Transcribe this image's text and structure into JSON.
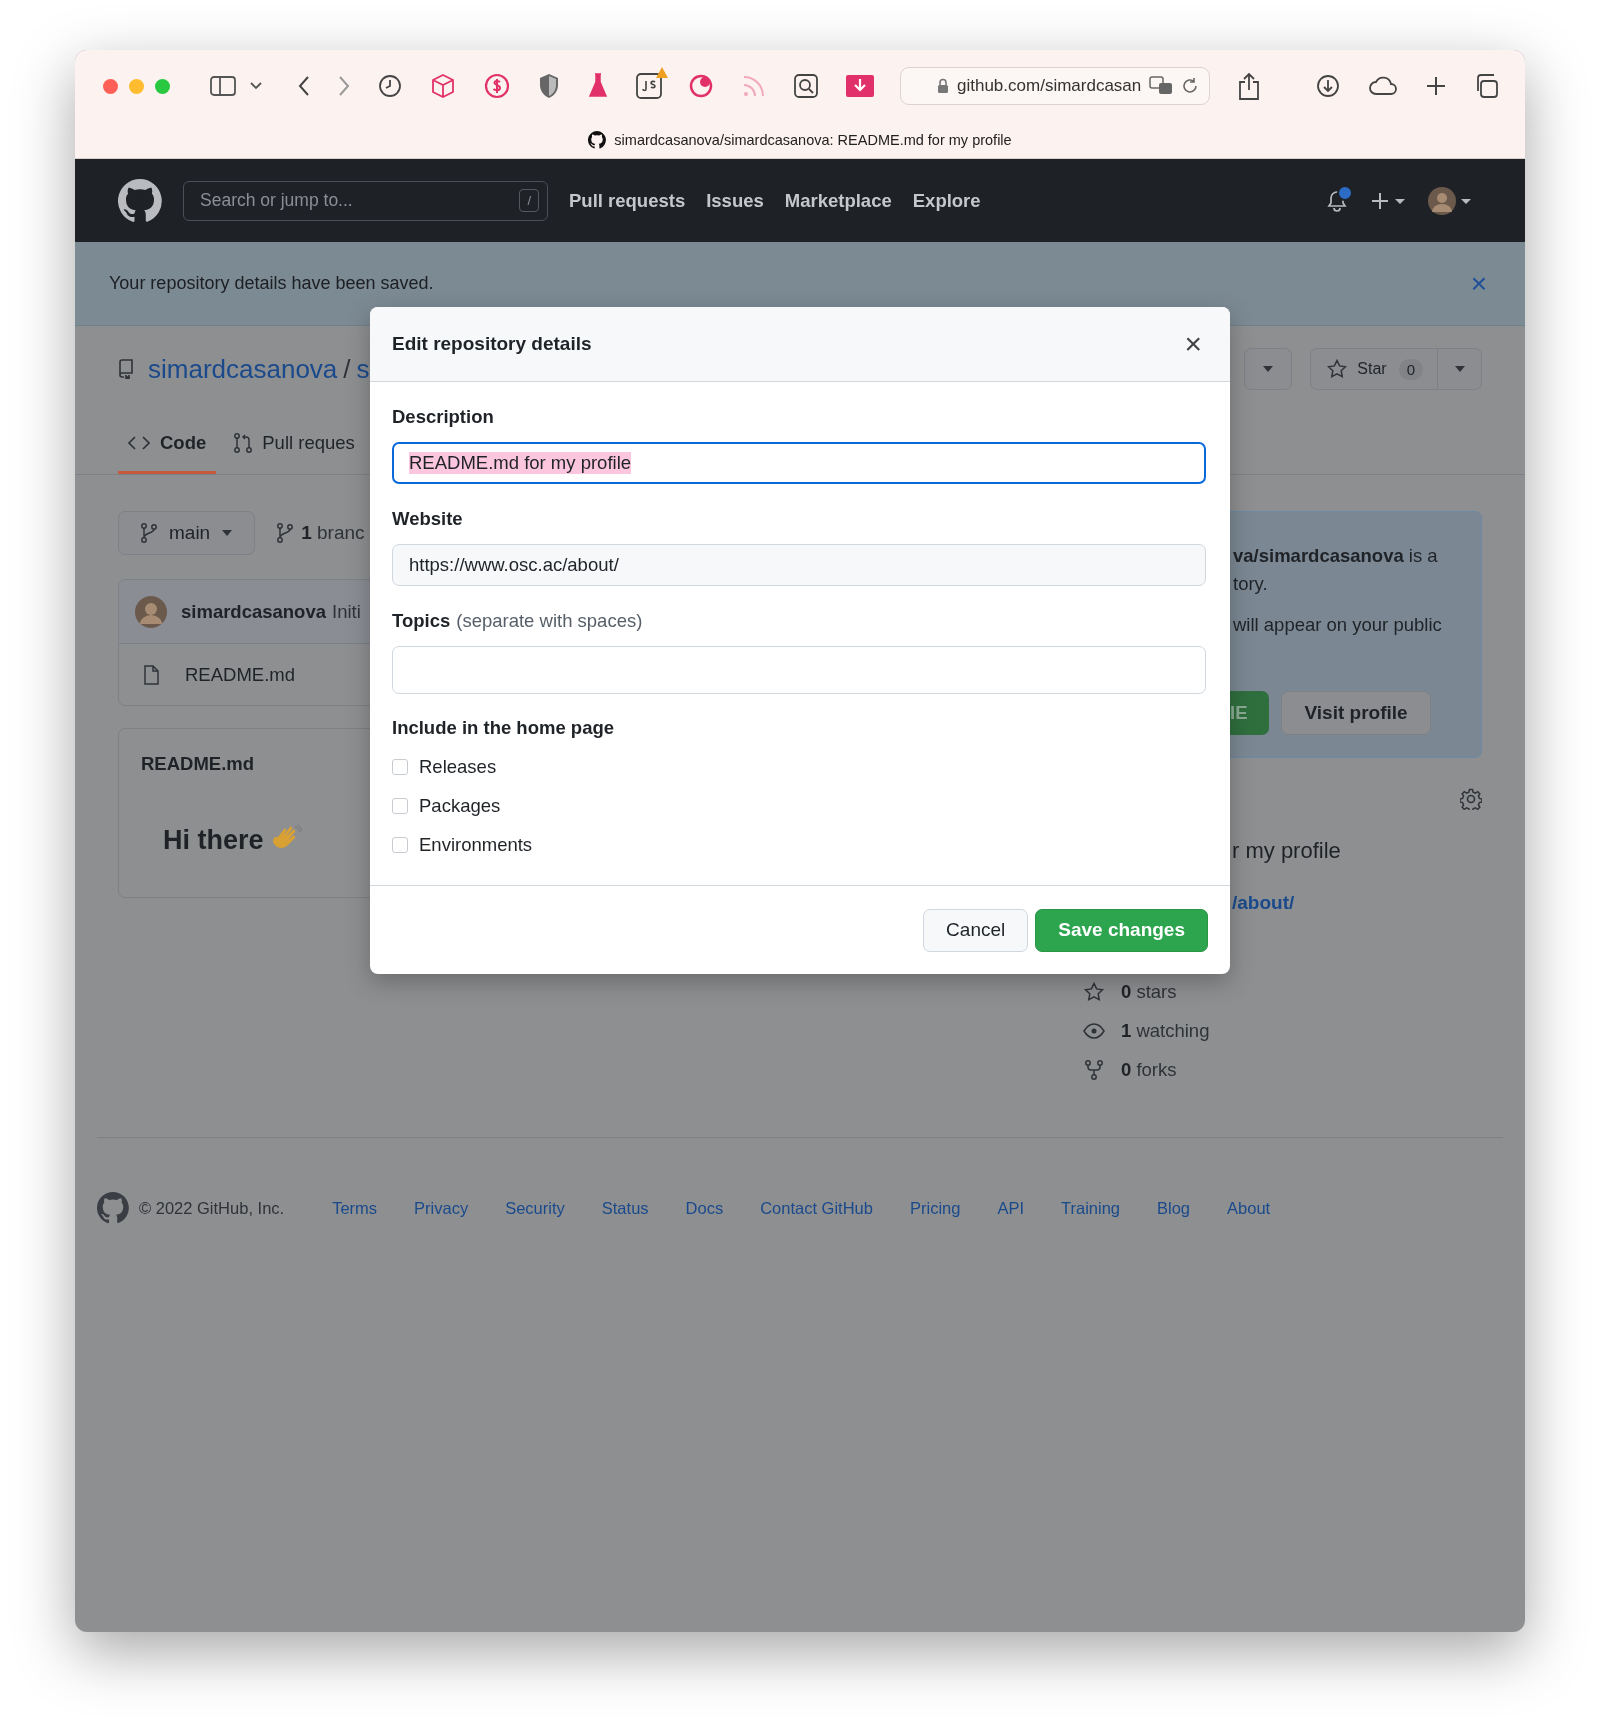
{
  "browser": {
    "url": "github.com/simardcasan",
    "page_title": "simardcasanova/simardcasanova: README.md for my profile"
  },
  "header": {
    "search_placeholder": "Search or jump to...",
    "search_key": "/",
    "nav": [
      "Pull requests",
      "Issues",
      "Marketplace",
      "Explore"
    ],
    "unread_notifications": true
  },
  "flash": {
    "message": "Your repository details have been saved.",
    "close": "×"
  },
  "repo": {
    "owner": "simardcasanova",
    "separator": "/",
    "name": "s",
    "star_label": "Star",
    "star_count": "0"
  },
  "tabs": [
    {
      "label": "Code",
      "selected": true
    },
    {
      "label": "Pull reques",
      "selected": false
    }
  ],
  "branch": {
    "name": "main",
    "count": "1",
    "count_label": "branc"
  },
  "commit": {
    "author": "simardcasanova",
    "message": "Initi"
  },
  "files": [
    {
      "name": "README.md"
    }
  ],
  "readme": {
    "title": "README.md",
    "heading": "Hi there"
  },
  "profile_notice": {
    "line_1": "**va/simardcasanova** is a",
    "line_2": "tory.",
    "line_3": "will appear on your public",
    "edit_button": "IE",
    "visit_button": "Visit profile"
  },
  "about": {
    "description": "r my profile",
    "website": "/about/",
    "stats": [
      {
        "kind": "stars",
        "count": "0",
        "label": "stars"
      },
      {
        "kind": "watching",
        "count": "1",
        "label": "watching"
      },
      {
        "kind": "forks",
        "count": "0",
        "label": "forks"
      }
    ]
  },
  "footer": {
    "copyright": "© 2022 GitHub, Inc.",
    "links": [
      "Terms",
      "Privacy",
      "Security",
      "Status",
      "Docs",
      "Contact GitHub",
      "Pricing",
      "API",
      "Training",
      "Blog",
      "About"
    ]
  },
  "dialog": {
    "title": "Edit repository details",
    "close": "×",
    "fields": [
      {
        "kind": "text",
        "label": "Description",
        "value": "README.md for my profile",
        "focused": true
      },
      {
        "kind": "text",
        "label": "Website",
        "value": "https://www.osc.ac/about/",
        "focused": false
      },
      {
        "kind": "topics",
        "label": "Topics",
        "hint": "(separate with spaces)",
        "focused": false
      }
    ],
    "include_label": "Include in the home page",
    "checkboxes": [
      {
        "label": "Releases",
        "checked": false
      },
      {
        "label": "Packages",
        "checked": false
      },
      {
        "label": "Environments",
        "checked": false
      }
    ],
    "cancel": "Cancel",
    "save": "Save changes"
  }
}
